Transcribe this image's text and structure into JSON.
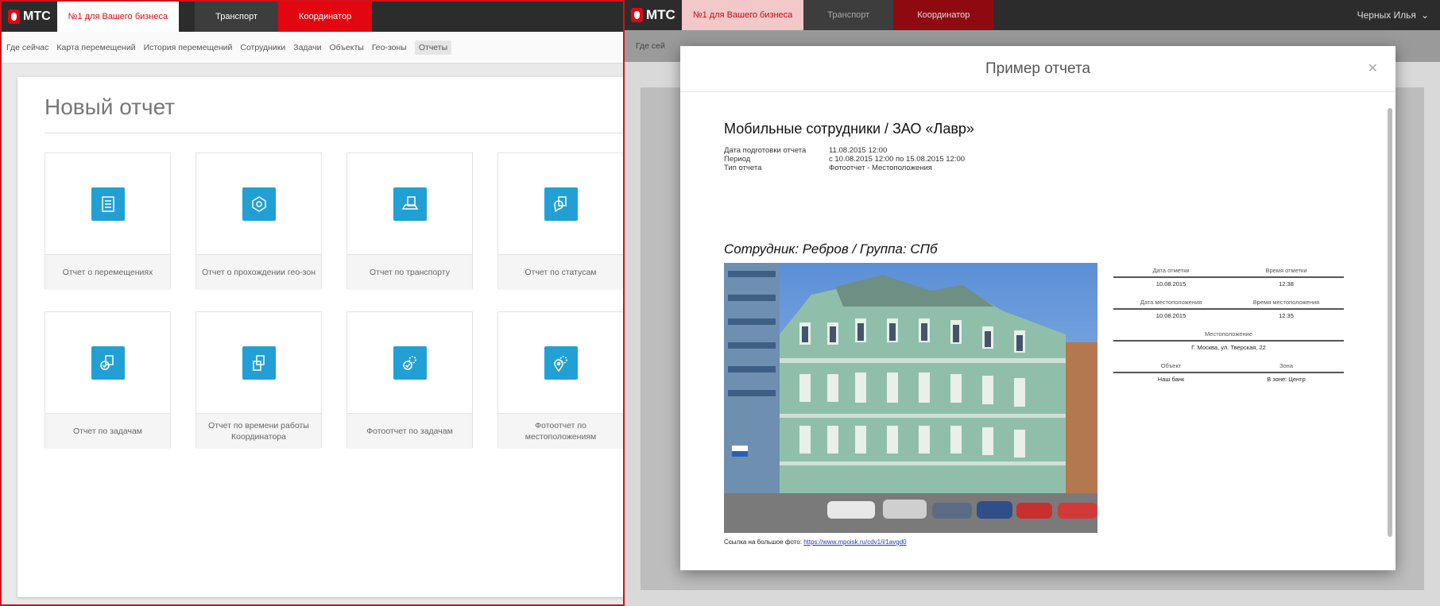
{
  "left": {
    "header": {
      "logo": "МТС",
      "tagline": "№1 для Вашего бизнеса",
      "tabs": [
        {
          "label": "Транспорт"
        },
        {
          "label": "Координатор"
        }
      ]
    },
    "subnav": [
      "Где сейчас",
      "Карта перемещений",
      "История перемещений",
      "Сотрудники",
      "Задачи",
      "Объекты",
      "Гео-зоны",
      "Отчеты"
    ],
    "page_title": "Новый отчет",
    "tiles": [
      {
        "label": "Отчет о перемещениях",
        "icon": "route-list-icon"
      },
      {
        "label": "Отчет о прохождении гео-зон",
        "icon": "geozone-icon"
      },
      {
        "label": "Отчет по транспорту",
        "icon": "car-report-icon"
      },
      {
        "label": "Отчет по статусам",
        "icon": "status-report-icon"
      },
      {
        "label": "Отчет по задачам",
        "icon": "task-report-icon"
      },
      {
        "label": "Отчет по времени работы Координатора",
        "icon": "time-report-icon"
      },
      {
        "label": "Фотоотчет по задачам",
        "icon": "photo-task-icon"
      },
      {
        "label": "Фотоотчет по местоположениям",
        "icon": "photo-location-icon"
      }
    ]
  },
  "right": {
    "header": {
      "logo": "МТС",
      "tagline": "№1 для Вашего бизнеса",
      "tabs": [
        {
          "label": "Транспорт"
        },
        {
          "label": "Координатор"
        }
      ],
      "user": "Черных Илья"
    },
    "bg_subnav": "Где сей",
    "modal": {
      "title": "Пример отчета",
      "report_title": "Мобильные сотрудники / ЗАО «Лавр»",
      "meta": [
        {
          "k": "Дата подготовки отчета",
          "v": "11.08.2015 12:00"
        },
        {
          "k": "Период",
          "v": "с 10.08.2015 12:00 по 15.08.2015 12:00"
        },
        {
          "k": "Тип отчета",
          "v": "Фотоотчет - Местоположения"
        }
      ],
      "employee": "Сотрудник: Ребров / Группа: СПб",
      "info": {
        "h1": "Дата отметки",
        "h2": "Время отметки",
        "v1": "10.08.2015",
        "v2": "12:38",
        "h3": "Дата местоположения",
        "h4": "Время местоположения",
        "v3": "10.08.2015",
        "v4": "12:35",
        "h5": "Местоположение",
        "v5": "Г. Москва, ул. Тверская, 22",
        "h6": "Объект",
        "h7": "Зона",
        "v6": "Наш банк",
        "v7": "В зоне: Центр"
      },
      "link_label": "Ссылка на большое фото:",
      "link_url": "https://www.mpoisk.ru/cdv1/i/1avgd0"
    }
  },
  "colors": {
    "brand_red": "#e30611",
    "tile_blue": "#22a0d5",
    "topbar": "#2c2c2c"
  }
}
